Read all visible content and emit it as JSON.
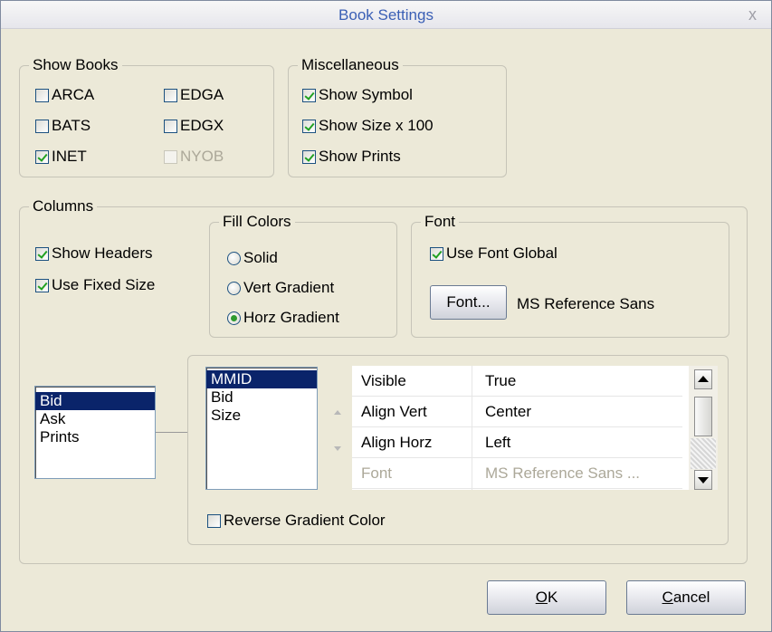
{
  "window": {
    "title": "Book Settings",
    "close": "x"
  },
  "show_books": {
    "legend": "Show Books",
    "items": [
      {
        "label": "ARCA",
        "checked": false,
        "enabled": true
      },
      {
        "label": "EDGA",
        "checked": false,
        "enabled": true
      },
      {
        "label": "BATS",
        "checked": false,
        "enabled": true
      },
      {
        "label": "EDGX",
        "checked": false,
        "enabled": true
      },
      {
        "label": "INET",
        "checked": true,
        "enabled": true
      },
      {
        "label": "NYOB",
        "checked": false,
        "enabled": false
      }
    ]
  },
  "misc": {
    "legend": "Miscellaneous",
    "show_symbol": "Show Symbol",
    "show_size": "Show Size x 100",
    "show_prints": "Show Prints"
  },
  "columns": {
    "legend": "Columns",
    "show_headers": "Show Headers",
    "use_fixed_size": "Use Fixed Size",
    "column_list": [
      "Bid",
      "Ask",
      "Prints"
    ],
    "selected_column": "Bid"
  },
  "fill_colors": {
    "legend": "Fill Colors",
    "options": [
      "Solid",
      "Vert Gradient",
      "Horz Gradient"
    ],
    "selected": "Horz Gradient"
  },
  "font": {
    "legend": "Font",
    "use_font_global": "Use Font Global",
    "font_button": "Font...",
    "font_name": "MS Reference Sans"
  },
  "field_list": [
    "MMID",
    "Bid",
    "Size"
  ],
  "selected_field": "MMID",
  "properties": [
    {
      "name": "Visible",
      "value": "True",
      "enabled": true
    },
    {
      "name": "Align Vert",
      "value": "Center",
      "enabled": true
    },
    {
      "name": "Align Horz",
      "value": "Left",
      "enabled": true
    },
    {
      "name": "Font",
      "value": "MS Reference Sans ...",
      "enabled": false
    }
  ],
  "reverse_gradient": "Reverse Gradient Color",
  "buttons": {
    "ok_underlined": "O",
    "ok_rest": "K",
    "cancel_underlined": "C",
    "cancel_rest": "ancel"
  }
}
